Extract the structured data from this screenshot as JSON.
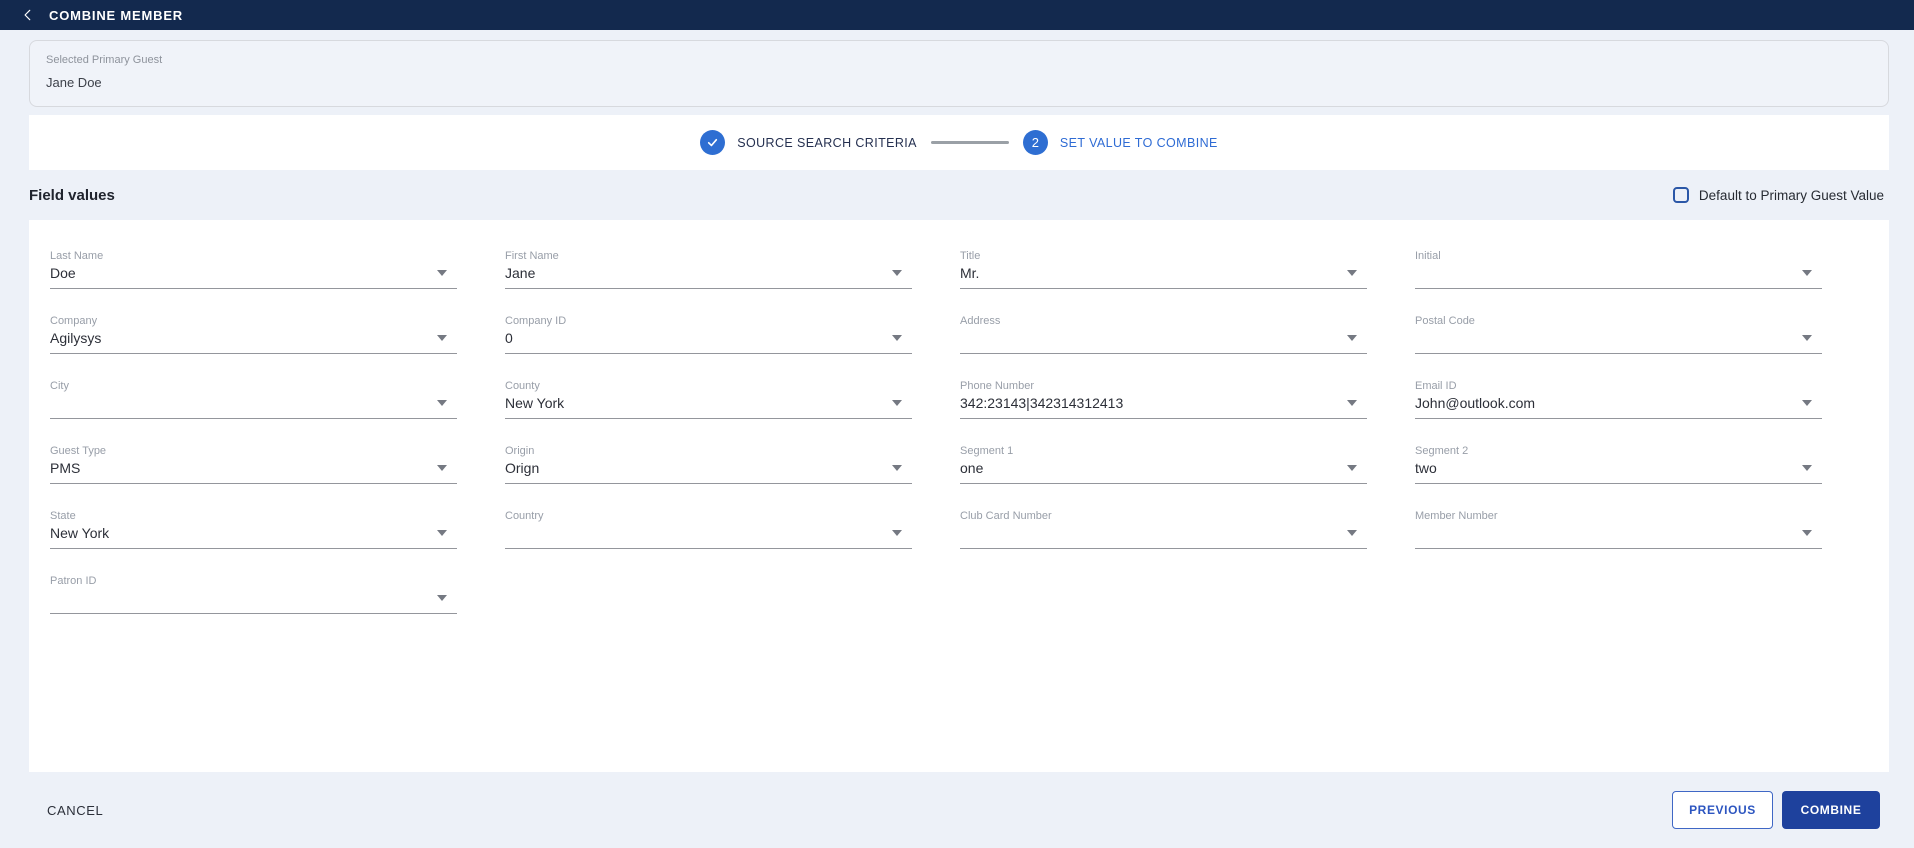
{
  "header": {
    "title": "COMBINE MEMBER"
  },
  "primary_guest": {
    "label": "Selected Primary Guest",
    "value": "Jane Doe"
  },
  "stepper": {
    "steps": [
      {
        "label": "SOURCE SEARCH CRITERIA",
        "state": "done"
      },
      {
        "number": "2",
        "label": "SET VALUE TO COMBINE",
        "state": "active"
      }
    ]
  },
  "section": {
    "title": "Field values",
    "checkbox_label": "Default to Primary Guest Value",
    "checkbox_checked": false
  },
  "fields": [
    {
      "label": "Last Name",
      "value": "Doe"
    },
    {
      "label": "First Name",
      "value": "Jane"
    },
    {
      "label": "Title",
      "value": "Mr."
    },
    {
      "label": "Initial",
      "value": ""
    },
    {
      "label": "Company",
      "value": "Agilysys"
    },
    {
      "label": "Company ID",
      "value": "0"
    },
    {
      "label": "Address",
      "value": ""
    },
    {
      "label": "Postal Code",
      "value": ""
    },
    {
      "label": "City",
      "value": ""
    },
    {
      "label": "County",
      "value": "New York"
    },
    {
      "label": "Phone Number",
      "value": "342:23143|342314312413"
    },
    {
      "label": "Email ID",
      "value": "John@outlook.com"
    },
    {
      "label": "Guest Type",
      "value": "PMS"
    },
    {
      "label": "Origin",
      "value": "Orign"
    },
    {
      "label": "Segment 1",
      "value": "one"
    },
    {
      "label": "Segment 2",
      "value": "two"
    },
    {
      "label": "State",
      "value": "New York"
    },
    {
      "label": "Country",
      "value": ""
    },
    {
      "label": "Club Card Number",
      "value": ""
    },
    {
      "label": "Member Number",
      "value": ""
    },
    {
      "label": "Patron ID",
      "value": ""
    }
  ],
  "footer": {
    "cancel": "CANCEL",
    "previous": "PREVIOUS",
    "combine": "COMBINE"
  },
  "colors": {
    "header_bg": "#13294e",
    "page_bg": "#edf1f8",
    "accent_blue": "#2e6ed2",
    "combine_bg": "#1e419d",
    "previous_border": "#3f67c5"
  }
}
